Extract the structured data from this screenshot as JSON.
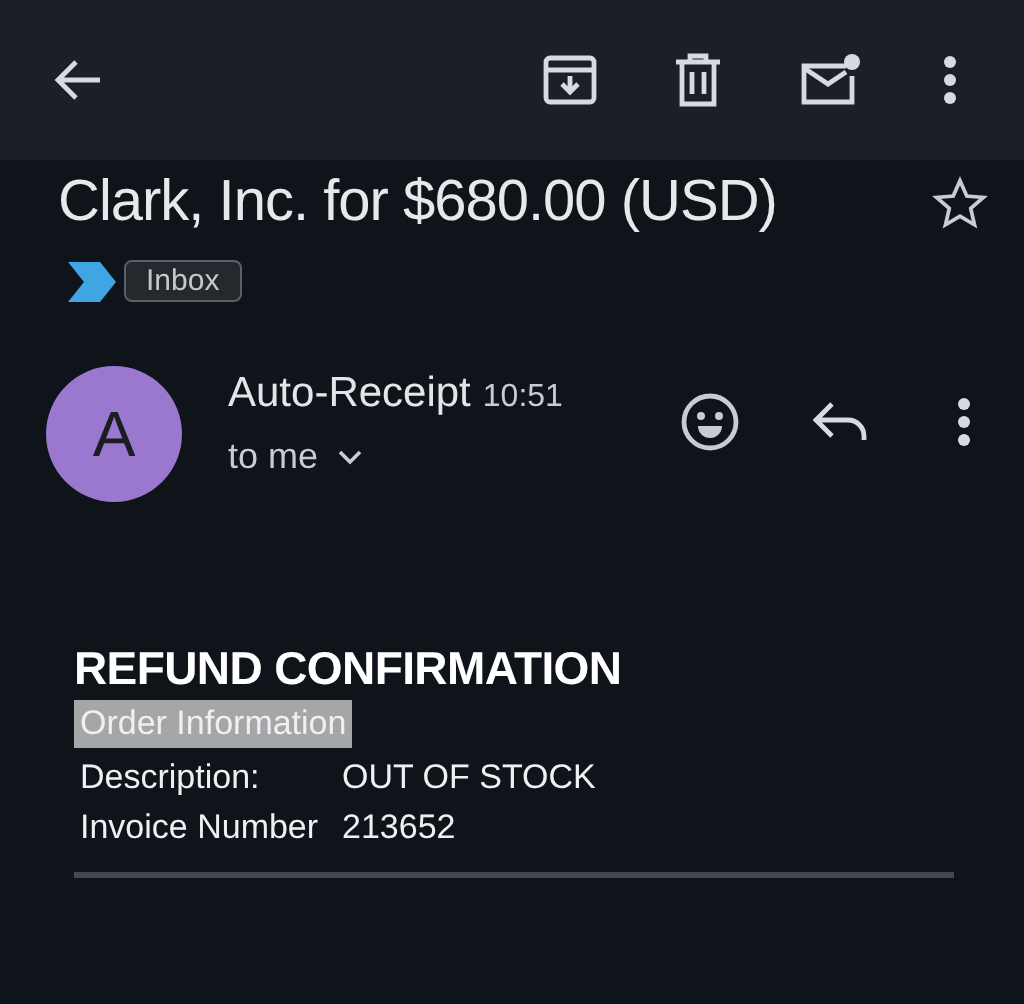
{
  "subject": "Clark, Inc. for $680.00 (USD)",
  "starred": false,
  "labels": [
    {
      "text": "Inbox"
    }
  ],
  "sender": {
    "initial": "A",
    "name": "Auto-Receipt",
    "time": "10:51",
    "recipient": "to me"
  },
  "body": {
    "heading": "REFUND CONFIRMATION",
    "section": "Order Information",
    "rows": [
      {
        "label": "Description:",
        "value": "OUT OF STOCK"
      },
      {
        "label": "Invoice Number",
        "value": "213652"
      }
    ]
  }
}
